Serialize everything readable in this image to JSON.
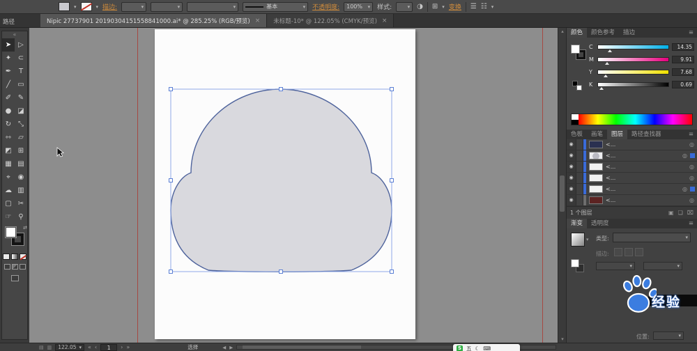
{
  "colors": {
    "accent_blue": "#3a6bd8",
    "selection_stroke": "#4e639c",
    "cloud_fill": "#d9d9de",
    "guide_red": "#a8403a",
    "link_orange": "#d08c3c",
    "baidu_blue": "#3b7de0",
    "sogou_green": "#2fae43"
  },
  "control_bar": {
    "stroke_label": "描边:",
    "brush_label": "基本",
    "opacity_label": "不透明度:",
    "opacity_value": "100%",
    "style_label": "样式:",
    "transform_label": "变换"
  },
  "document_tabs": {
    "tab1": {
      "title": "Nipic 27737901 20190304151558841000.ai* @ 285.25% (RGB/预览)",
      "close": "×"
    },
    "tab2": {
      "title": "未标题-10* @ 122.05% (CMYK/预览)",
      "close": "×"
    }
  },
  "left": {
    "panel_label": "路径",
    "collapse_icon": "«"
  },
  "tools": {
    "selection": "➤",
    "direct_selection": "▷",
    "magic_wand": "✦",
    "lasso": "⊂",
    "pen": "✒",
    "type": "T",
    "line": "╱",
    "rectangle": "▭",
    "paintbrush": "✐",
    "pencil": "✎",
    "blob_brush": "●",
    "eraser": "◪",
    "rotate": "↻",
    "scale": "⤡",
    "width": "⇿",
    "free_transform": "▱",
    "shape_builder": "◩",
    "perspective": "⊞",
    "mesh": "▦",
    "gradient": "▤",
    "eyedropper": "⌖",
    "blend": "◉",
    "symbol_sprayer": "☁",
    "graph": "▥",
    "artboard_tool": "▢",
    "slice": "✂",
    "hand": "☞",
    "zoom": "⚲"
  },
  "icons": {
    "menu": "≡",
    "chevron_down": "▾",
    "swap": "⇄",
    "eye": "◉",
    "target": "◎",
    "recolor": "◑",
    "grid": "⊞",
    "align_a": "☰",
    "align_b": "☷",
    "first": "«",
    "prev": "‹",
    "next": "›",
    "last": "»",
    "scroll_left": "◀",
    "scroll_right": "▶",
    "up": "▴",
    "down": "▾",
    "folder": "▣",
    "new_layer": "❏",
    "delete": "⌧",
    "status_a": "▤",
    "status_b": "▥"
  },
  "color_panel": {
    "tab_color": "颜色",
    "tab_guide": "颜色参考",
    "tab_stroke": "描边",
    "channels": {
      "c": {
        "label": "C",
        "value": "14.35"
      },
      "m": {
        "label": "M",
        "value": "9.91"
      },
      "y": {
        "label": "Y",
        "value": "7.68"
      },
      "k": {
        "label": "K",
        "value": "0.69"
      }
    }
  },
  "panel_tabs": {
    "swatches": "色板",
    "brushes": "画笔",
    "layers": "图层",
    "pathfinder": "路径查找器"
  },
  "layers": {
    "rows": {
      "r1": {
        "label": "<..."
      },
      "r2": {
        "label": "<..."
      },
      "r3": {
        "label": "<..."
      },
      "r4": {
        "label": "<..."
      },
      "r5": {
        "label": "<..."
      },
      "r6": {
        "label": "<..."
      }
    },
    "footer": "1 个图层"
  },
  "gradient_panel": {
    "tab_gradient": "渐变",
    "tab_transparency": "透明度",
    "type_label": "类型:",
    "stroke_label": "描边:",
    "location_label": "位置:"
  },
  "status_bar": {
    "zoom_value": "122.05",
    "artboard_number": "1",
    "tool_name": "选择"
  },
  "ime": {
    "logo": "S",
    "mode": "五"
  },
  "watermark": {
    "text": "经验"
  }
}
